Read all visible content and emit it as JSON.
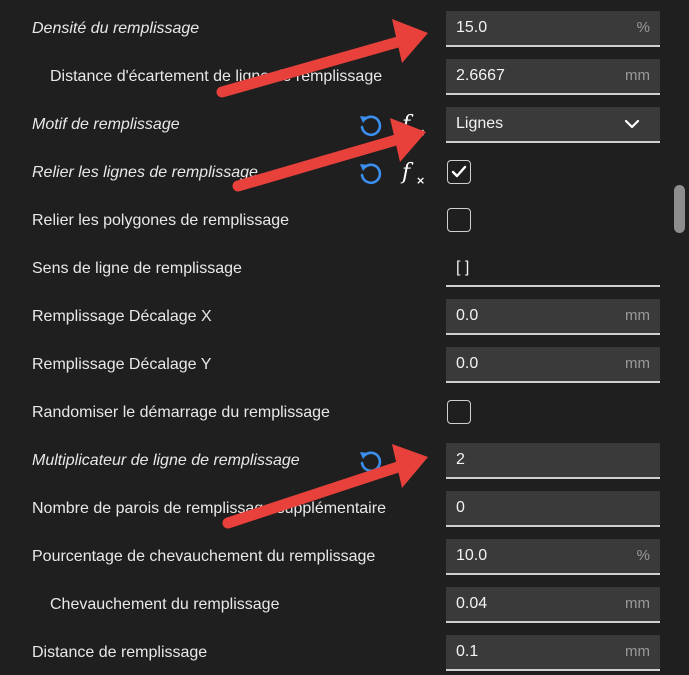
{
  "settings": [
    {
      "label": "Densité du remplissage",
      "value": "15.0",
      "unit": "%",
      "type": "input",
      "modified": true,
      "indent": false
    },
    {
      "label": "Distance d'écartement de ligne de remplissage",
      "value": "2.6667",
      "unit": "mm",
      "type": "input",
      "modified": false,
      "indent": true
    },
    {
      "label": "Motif de remplissage",
      "value": "Lignes",
      "unit": "",
      "type": "select",
      "modified": true,
      "indent": false,
      "reset": true,
      "function": true
    },
    {
      "label": "Relier les lignes de remplissage",
      "value": "",
      "unit": "",
      "type": "checkbox",
      "checked": true,
      "modified": true,
      "indent": false,
      "reset": true,
      "function": true
    },
    {
      "label": "Relier les polygones de remplissage",
      "value": "",
      "unit": "",
      "type": "checkbox",
      "checked": false,
      "modified": false,
      "indent": false
    },
    {
      "label": "Sens de ligne de remplissage",
      "value": "[ ]",
      "unit": "",
      "type": "text",
      "modified": false,
      "indent": false
    },
    {
      "label": "Remplissage Décalage X",
      "value": "0.0",
      "unit": "mm",
      "type": "input",
      "modified": false,
      "indent": false
    },
    {
      "label": "Remplissage Décalage Y",
      "value": "0.0",
      "unit": "mm",
      "type": "input",
      "modified": false,
      "indent": false
    },
    {
      "label": "Randomiser le démarrage du remplissage",
      "value": "",
      "unit": "",
      "type": "checkbox",
      "checked": false,
      "modified": false,
      "indent": false
    },
    {
      "label": "Multiplicateur de ligne de remplissage",
      "value": "2",
      "unit": "",
      "type": "input",
      "modified": true,
      "indent": false,
      "reset": true
    },
    {
      "label": "Nombre de parois de remplissage supplémentaire",
      "value": "0",
      "unit": "",
      "type": "input",
      "modified": false,
      "indent": false
    },
    {
      "label": "Pourcentage de chevauchement du remplissage",
      "value": "10.0",
      "unit": "%",
      "type": "input",
      "modified": false,
      "indent": false
    },
    {
      "label": "Chevauchement du remplissage",
      "value": "0.04",
      "unit": "mm",
      "type": "input",
      "modified": false,
      "indent": true
    },
    {
      "label": "Distance de remplissage",
      "value": "0.1",
      "unit": "mm",
      "type": "input",
      "modified": false,
      "indent": false
    }
  ],
  "icons": {
    "reset": "reset-icon",
    "function": "function-icon",
    "chevron": "chevron-down-icon",
    "check": "check-icon"
  },
  "colors": {
    "background": "#1f1f1f",
    "field": "#3a3a3a",
    "reset_icon": "#3b8ff0",
    "annotation_arrow": "#e8413c"
  }
}
